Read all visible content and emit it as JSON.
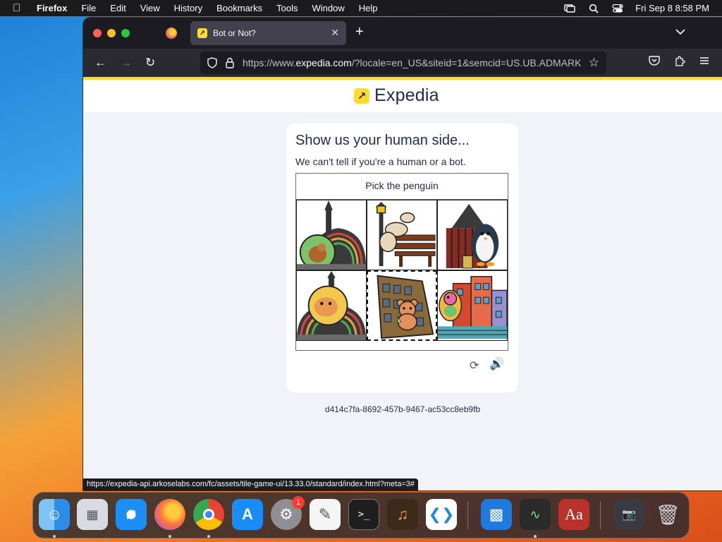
{
  "menubar": {
    "app_name": "Firefox",
    "menus": [
      "File",
      "Edit",
      "View",
      "History",
      "Bookmarks",
      "Tools",
      "Window",
      "Help"
    ],
    "datetime": "Fri Sep 8  8:58 PM"
  },
  "browser": {
    "tab_title": "Bot or Not?",
    "url_prefix": "https://www.",
    "url_domain": "expedia.com",
    "url_rest": "/?locale=en_US&siteid=1&semcid=US.UB.ADMARK",
    "status_url": "https://expedia-api.arkoselabs.com/fc/assets/tile-game-ui/13.33.0/standard/index.html?meta=3#"
  },
  "page": {
    "brand": "Expedia",
    "brand_color": "#fddb32",
    "heading": "Show us your human side...",
    "subheading": "We can't tell if you're a human or a bot.",
    "prompt": "Pick the penguin",
    "session_id": "d414c7fa-8692-457b-9467-ac53cc8eb9fb",
    "tiles": [
      {
        "label": "squirrel-in-bubble",
        "selected": false
      },
      {
        "label": "seal-on-bench",
        "selected": false
      },
      {
        "label": "penguin-by-building",
        "selected": false
      },
      {
        "label": "hamster-in-bubble",
        "selected": false
      },
      {
        "label": "bear-by-building",
        "selected": true
      },
      {
        "label": "bird-by-buildings",
        "selected": false
      }
    ]
  },
  "dock": {
    "items": [
      "Finder",
      "Launchpad",
      "Safari",
      "Firefox",
      "Chrome",
      "App Store",
      "System Settings",
      "TextEdit",
      "Terminal",
      "GarageBand",
      "VS Code",
      "Keynote",
      "Activity Monitor",
      "Dictionary",
      "Photo Booth",
      "Trash"
    ],
    "settings_badge": "1"
  }
}
